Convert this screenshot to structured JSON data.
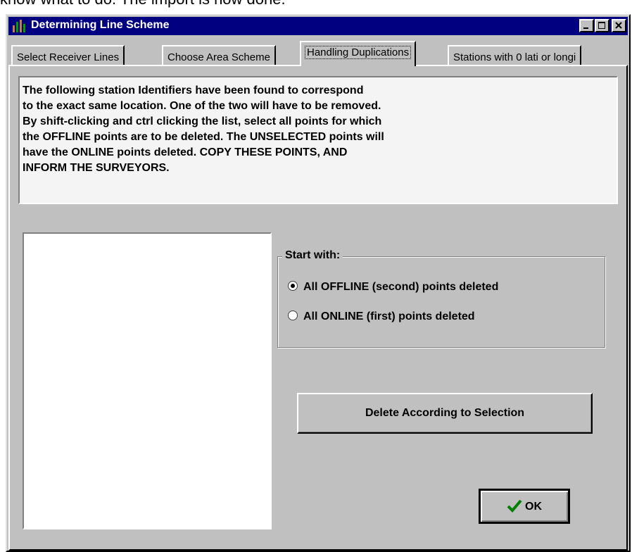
{
  "background_text": "know what to do. The import is now done.",
  "window": {
    "title": "Determining Line Scheme",
    "icon": "app-icon"
  },
  "tabs": [
    {
      "label": "Select Receiver Lines",
      "active": false
    },
    {
      "label": "Choose Area Scheme",
      "active": false
    },
    {
      "label": "Handling Duplications",
      "active": true
    },
    {
      "label": "Stations with 0 lati or longi",
      "active": false
    }
  ],
  "info": {
    "text": "The following station Identifiers have been found to correspond\nto the exact same location.  One of the two will have to be removed.\nBy shift-clicking and  ctrl clicking the list, select all points for which\nthe OFFLINE points are to be deleted.  The UNSELECTED points will\nhave the ONLINE points deleted.  COPY THESE POINTS, AND\nINFORM THE SURVEYORS."
  },
  "start_with": {
    "legend": "Start with:",
    "options": [
      {
        "label": "All OFFLINE (second) points deleted",
        "selected": true
      },
      {
        "label": "All ONLINE (first) points deleted",
        "selected": false
      }
    ]
  },
  "buttons": {
    "delete_label": "Delete According to Selection",
    "ok_label": "OK"
  },
  "colors": {
    "titlebar": "#000080",
    "face": "#c0c0c0",
    "check": "#008000"
  }
}
